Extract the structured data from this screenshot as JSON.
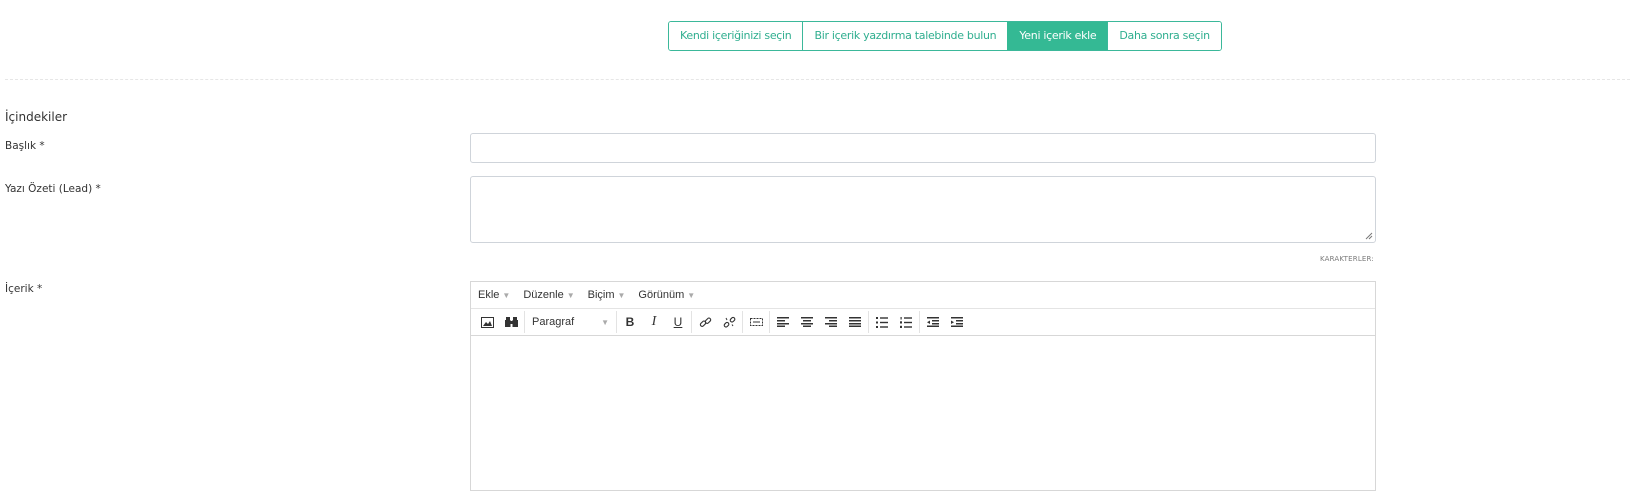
{
  "tabs": [
    {
      "label": "Kendi içeriğinizi seçin",
      "active": false
    },
    {
      "label": "Bir içerik yazdırma talebinde bulun",
      "active": false
    },
    {
      "label": "Yeni içerik ekle",
      "active": true
    },
    {
      "label": "Daha sonra seçin",
      "active": false
    }
  ],
  "form": {
    "section_title": "İçindekiler",
    "title_label": "Başlık *",
    "title_value": "",
    "lead_label": "Yazı Özeti (Lead) *",
    "lead_value": "",
    "char_counter": "KARAKTERLER:",
    "content_label": "İçerik *"
  },
  "editor": {
    "menus": [
      "Ekle",
      "Düzenle",
      "Biçim",
      "Görünüm"
    ],
    "format_select": "Paragraf",
    "toolbar_icons": [
      "image-icon",
      "binoculars-icon",
      "bold-icon",
      "italic-icon",
      "underline-icon",
      "link-icon",
      "unlink-icon",
      "page-break-icon",
      "align-left-icon",
      "align-center-icon",
      "align-right-icon",
      "align-justify-icon",
      "bullet-list-icon",
      "numbered-list-icon",
      "outdent-icon",
      "indent-icon"
    ],
    "bold_glyph": "B",
    "italic_glyph": "I",
    "underline_glyph": "U"
  },
  "colors": {
    "accent": "#34b994",
    "border": "#cfd4da"
  }
}
